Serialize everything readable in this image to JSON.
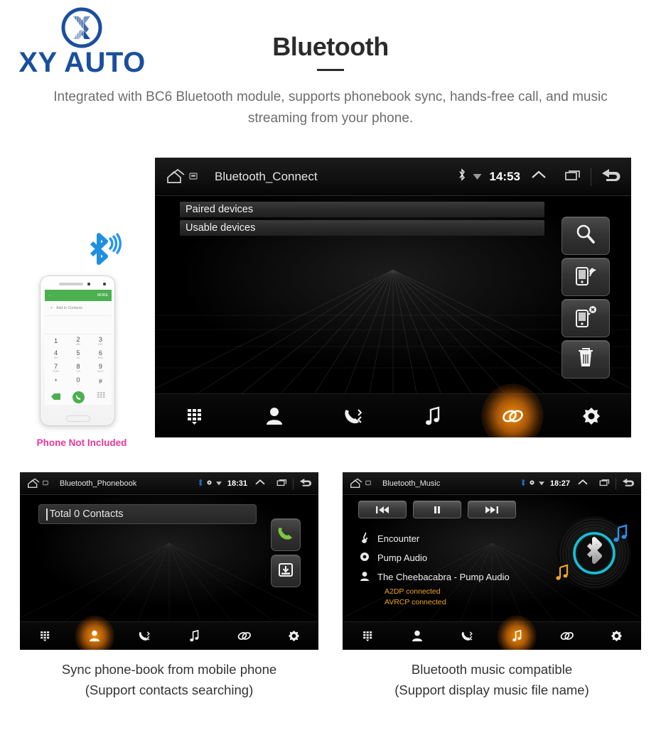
{
  "brand": {
    "name": "XY AUTO",
    "logo_icon": "xy-circle-logo",
    "color": "#1a4f9c"
  },
  "page": {
    "title": "Bluetooth",
    "subtitle": "Integrated with BC6 Bluetooth module, supports phonebook sync, hands-free call, and music streaming from your phone."
  },
  "phone_illustration": {
    "bluetooth_icon": "bluetooth-signal-icon",
    "caption": "Phone Not Included",
    "caption_color": "#e8379a",
    "screen": {
      "back_icon": "back-arrow-icon",
      "more_label": "MORE",
      "add_contact_label": "Add to Contacts",
      "keys": [
        {
          "digit": "1",
          "sub": ""
        },
        {
          "digit": "2",
          "sub": "ABC"
        },
        {
          "digit": "3",
          "sub": "DEF"
        },
        {
          "digit": "4",
          "sub": "GHI"
        },
        {
          "digit": "5",
          "sub": "JKL"
        },
        {
          "digit": "6",
          "sub": "MNO"
        },
        {
          "digit": "7",
          "sub": "PQRS"
        },
        {
          "digit": "8",
          "sub": "TUV"
        },
        {
          "digit": "9",
          "sub": "WXYZ"
        },
        {
          "digit": "*",
          "sub": ""
        },
        {
          "digit": "0",
          "sub": "+"
        },
        {
          "digit": "#",
          "sub": ""
        }
      ],
      "call_icon": "call-icon",
      "backspace_icon": "backspace-icon",
      "keypad_icon": "keypad-hide-icon"
    }
  },
  "main_screen": {
    "status": {
      "home_icon": "home-icon",
      "screen_icon": "display-icon",
      "title": "Bluetooth_Connect",
      "bluetooth_icon": "bluetooth-icon",
      "wifi_icon": "wifi-icon",
      "time": "14:53",
      "chevron_icon": "chevron-up-icon",
      "recents_icon": "recents-icon",
      "back_icon": "back-arrow-icon"
    },
    "lists": [
      {
        "label": "Paired devices"
      },
      {
        "label": "Usable devices"
      }
    ],
    "side_buttons": [
      {
        "icon": "search-icon",
        "name": "search-devices-button"
      },
      {
        "icon": "phone-connect-icon",
        "name": "connect-device-button"
      },
      {
        "icon": "phone-disconnect-icon",
        "name": "disconnect-device-button"
      },
      {
        "icon": "trash-icon",
        "name": "delete-device-button"
      }
    ],
    "nav": [
      {
        "icon": "dialpad-icon",
        "name": "nav-dialpad",
        "active": false
      },
      {
        "icon": "contacts-icon",
        "name": "nav-contacts",
        "active": false
      },
      {
        "icon": "call-history-icon",
        "name": "nav-call-history",
        "active": false
      },
      {
        "icon": "music-icon",
        "name": "nav-music",
        "active": false
      },
      {
        "icon": "link-icon",
        "name": "nav-connect",
        "active": true
      },
      {
        "icon": "settings-icon",
        "name": "nav-settings",
        "active": false
      }
    ],
    "active_accent": "#ff960a"
  },
  "phonebook_screen": {
    "status": {
      "home_icon": "home-icon",
      "screen_icon": "display-icon",
      "title": "Bluetooth_Phonebook",
      "bluetooth_icon": "bluetooth-icon",
      "gps_icon": "gps-icon",
      "wifi_icon": "wifi-icon",
      "time": "18:31",
      "chevron_icon": "chevron-up-icon",
      "recents_icon": "recents-icon",
      "back_icon": "back-arrow-icon"
    },
    "search_value": "Total 0 Contacts",
    "search_placeholder": "Total 0 Contacts",
    "side_buttons": [
      {
        "icon": "green-call-icon",
        "name": "dial-button"
      },
      {
        "icon": "download-sync-icon",
        "name": "sync-contacts-button"
      }
    ],
    "nav": [
      {
        "icon": "dialpad-icon",
        "name": "nav-dialpad",
        "active": false
      },
      {
        "icon": "contacts-icon",
        "name": "nav-contacts",
        "active": true
      },
      {
        "icon": "call-history-icon",
        "name": "nav-call-history",
        "active": false
      },
      {
        "icon": "music-icon",
        "name": "nav-music",
        "active": false
      },
      {
        "icon": "link-icon",
        "name": "nav-connect",
        "active": false
      },
      {
        "icon": "settings-icon",
        "name": "nav-settings",
        "active": false
      }
    ]
  },
  "music_screen": {
    "status": {
      "home_icon": "home-icon",
      "screen_icon": "display-icon",
      "title": "Bluetooth_Music",
      "bluetooth_icon": "bluetooth-icon",
      "gps_icon": "gps-icon",
      "wifi_icon": "wifi-icon",
      "time": "18:27",
      "chevron_icon": "chevron-up-icon",
      "recents_icon": "recents-icon",
      "back_icon": "back-arrow-icon"
    },
    "controls": [
      {
        "icon": "previous-track-icon",
        "name": "previous-button"
      },
      {
        "icon": "pause-icon",
        "name": "pause-button"
      },
      {
        "icon": "next-track-icon",
        "name": "next-button"
      }
    ],
    "track": {
      "title": "Encounter",
      "title_icon": "note-icon",
      "album": "Pump Audio",
      "album_icon": "disc-icon",
      "artist": "The Cheebacabra - Pump Audio",
      "artist_icon": "person-icon"
    },
    "profiles": [
      "A2DP connected",
      "AVRCP connected"
    ],
    "profile_color": "#f0a326",
    "artwork_icon": "vinyl-bluetooth-icon",
    "nav": [
      {
        "icon": "dialpad-icon",
        "name": "nav-dialpad",
        "active": false
      },
      {
        "icon": "contacts-icon",
        "name": "nav-contacts",
        "active": false
      },
      {
        "icon": "call-history-icon",
        "name": "nav-call-history",
        "active": false
      },
      {
        "icon": "music-icon",
        "name": "nav-music",
        "active": true
      },
      {
        "icon": "link-icon",
        "name": "nav-connect",
        "active": false
      },
      {
        "icon": "settings-icon",
        "name": "nav-settings",
        "active": false
      }
    ]
  },
  "captions": {
    "left_line1": "Sync phone-book from mobile phone",
    "left_line2": "(Support contacts searching)",
    "right_line1": "Bluetooth music compatible",
    "right_line2": "(Support display music file name)"
  }
}
